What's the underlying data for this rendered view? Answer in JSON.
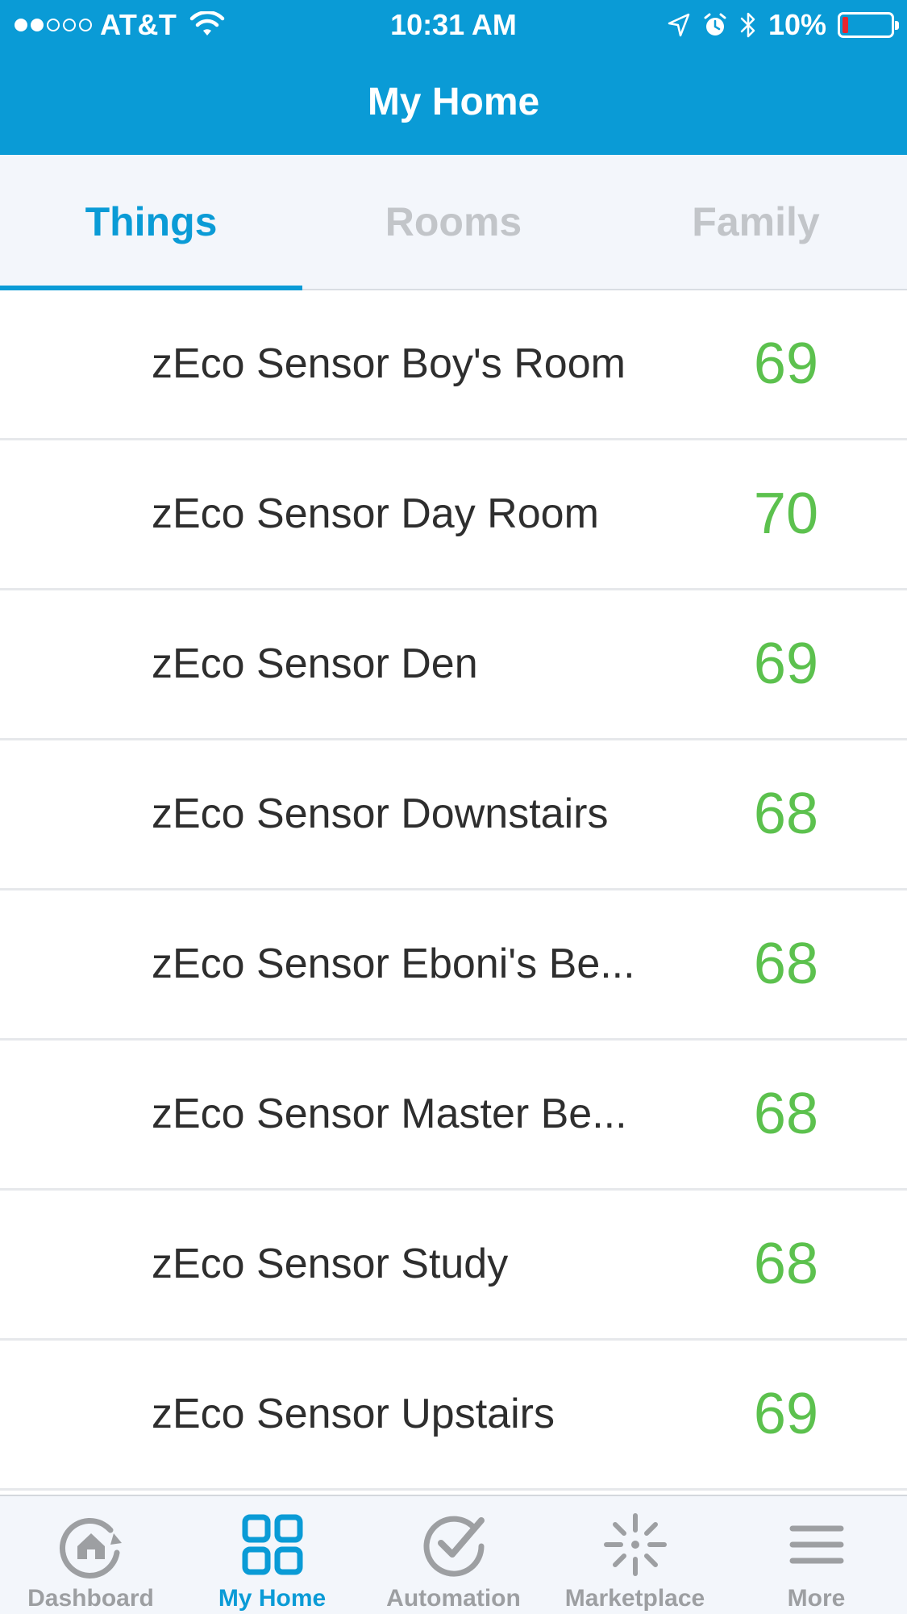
{
  "status_bar": {
    "carrier": "AT&T",
    "signal_bars_filled": 2,
    "signal_bars_total": 5,
    "time": "10:31 AM",
    "battery_percent": "10%",
    "icons": [
      "wifi-icon",
      "location-arrow-icon",
      "alarm-icon",
      "bluetooth-icon",
      "battery-icon"
    ]
  },
  "header": {
    "title": "My Home",
    "background_color": "#0a9bd6"
  },
  "tabs": [
    {
      "label": "Things",
      "active": true
    },
    {
      "label": "Rooms",
      "active": false
    },
    {
      "label": "Family",
      "active": false
    }
  ],
  "things": [
    {
      "name": "zEco Sensor Boy's Room",
      "value": "69"
    },
    {
      "name": "zEco Sensor Day Room",
      "value": "70"
    },
    {
      "name": "zEco Sensor Den",
      "value": "69"
    },
    {
      "name": "zEco Sensor Downstairs",
      "value": "68"
    },
    {
      "name": "zEco Sensor Eboni's Be...",
      "value": "68"
    },
    {
      "name": "zEco Sensor Master Be...",
      "value": "68"
    },
    {
      "name": "zEco Sensor Study",
      "value": "68"
    },
    {
      "name": "zEco Sensor Upstairs",
      "value": "69"
    }
  ],
  "value_color": "#5cc14e",
  "tabbar": [
    {
      "label": "Dashboard",
      "icon": "dashboard-home-icon",
      "active": false
    },
    {
      "label": "My Home",
      "icon": "grid-icon",
      "active": true
    },
    {
      "label": "Automation",
      "icon": "checkmark-circle-icon",
      "active": false
    },
    {
      "label": "Marketplace",
      "icon": "sparkle-icon",
      "active": false
    },
    {
      "label": "More",
      "icon": "menu-icon",
      "active": false
    }
  ]
}
